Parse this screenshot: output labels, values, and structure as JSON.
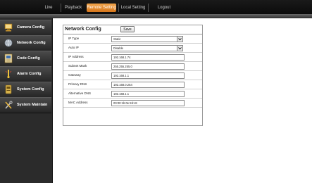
{
  "topnav": {
    "tabs": [
      {
        "label": "Live"
      },
      {
        "label": "Playback"
      },
      {
        "label": "Remote Setting"
      },
      {
        "label": "Local Setting"
      },
      {
        "label": "Logout"
      }
    ],
    "active_color": "#e08a2c"
  },
  "sidebar": {
    "items": [
      {
        "label": "Camera Config",
        "icon": "camera-config-icon"
      },
      {
        "label": "Network Config",
        "icon": "network-config-icon"
      },
      {
        "label": "Code Config",
        "icon": "code-config-icon"
      },
      {
        "label": "Alarm Config",
        "icon": "alarm-config-icon"
      },
      {
        "label": "System Config",
        "icon": "system-config-icon"
      },
      {
        "label": "System Maintain",
        "icon": "system-maintain-icon"
      }
    ]
  },
  "network": {
    "title": "Network Config",
    "save_label": "Save",
    "rows": [
      {
        "label": "IP Type",
        "value": "Static",
        "control": "dropdown"
      },
      {
        "label": "Auto IP",
        "value": "Disable",
        "control": "dropdown"
      },
      {
        "label": "IP Address",
        "value": "192.168.1.74",
        "control": "text"
      },
      {
        "label": "Subnet Mask",
        "value": "255.255.255.0",
        "control": "text"
      },
      {
        "label": "Gateway",
        "value": "192.168.1.1",
        "control": "text"
      },
      {
        "label": "Primary DNS",
        "value": "192.168.0.254",
        "control": "text"
      },
      {
        "label": "Alternative DNS",
        "value": "192.168.1.1",
        "control": "text"
      },
      {
        "label": "MAC Address",
        "value": "00:00:1b:0e:2d:c8",
        "control": "text"
      }
    ]
  }
}
